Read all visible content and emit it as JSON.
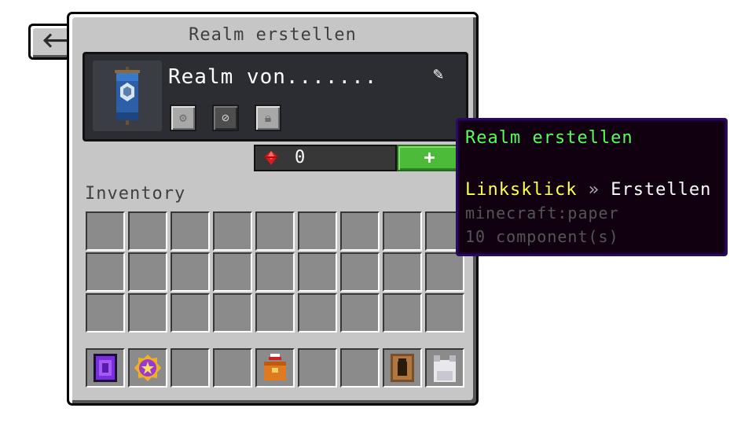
{
  "back": {
    "icon": "arrow-left-icon"
  },
  "panel": {
    "title": "Realm erstellen"
  },
  "realm": {
    "name": "Realm von.......",
    "banner_icon": "banner-icon",
    "edit_icon": "pencil-icon",
    "options": [
      {
        "icon": "gear-icon"
      },
      {
        "icon": "no-entry-icon"
      },
      {
        "icon": "lock-icon"
      }
    ]
  },
  "currency": {
    "icon": "red-gem-icon",
    "count": "0",
    "add_label": "+"
  },
  "inventory": {
    "label": "Inventory"
  },
  "hotbar": {
    "items": [
      "nether-portal-icon",
      "star-badge-icon",
      "",
      "",
      "lunch-box-icon",
      "",
      "",
      "door-icon",
      "iron-chestplate-icon"
    ]
  },
  "tooltip": {
    "title": "Realm erstellen",
    "action_key": "Linksklick",
    "action_sep": "»",
    "action_value": "Erstellen",
    "item_id": "minecraft:paper",
    "components": "10 component(s)"
  },
  "colors": {
    "panel_bg": "#c6c6c6",
    "slot_bg": "#8b8b8b",
    "tooltip_bg": "#100010",
    "tooltip_title": "#55ff55",
    "add_button": "#4dbb3a"
  }
}
